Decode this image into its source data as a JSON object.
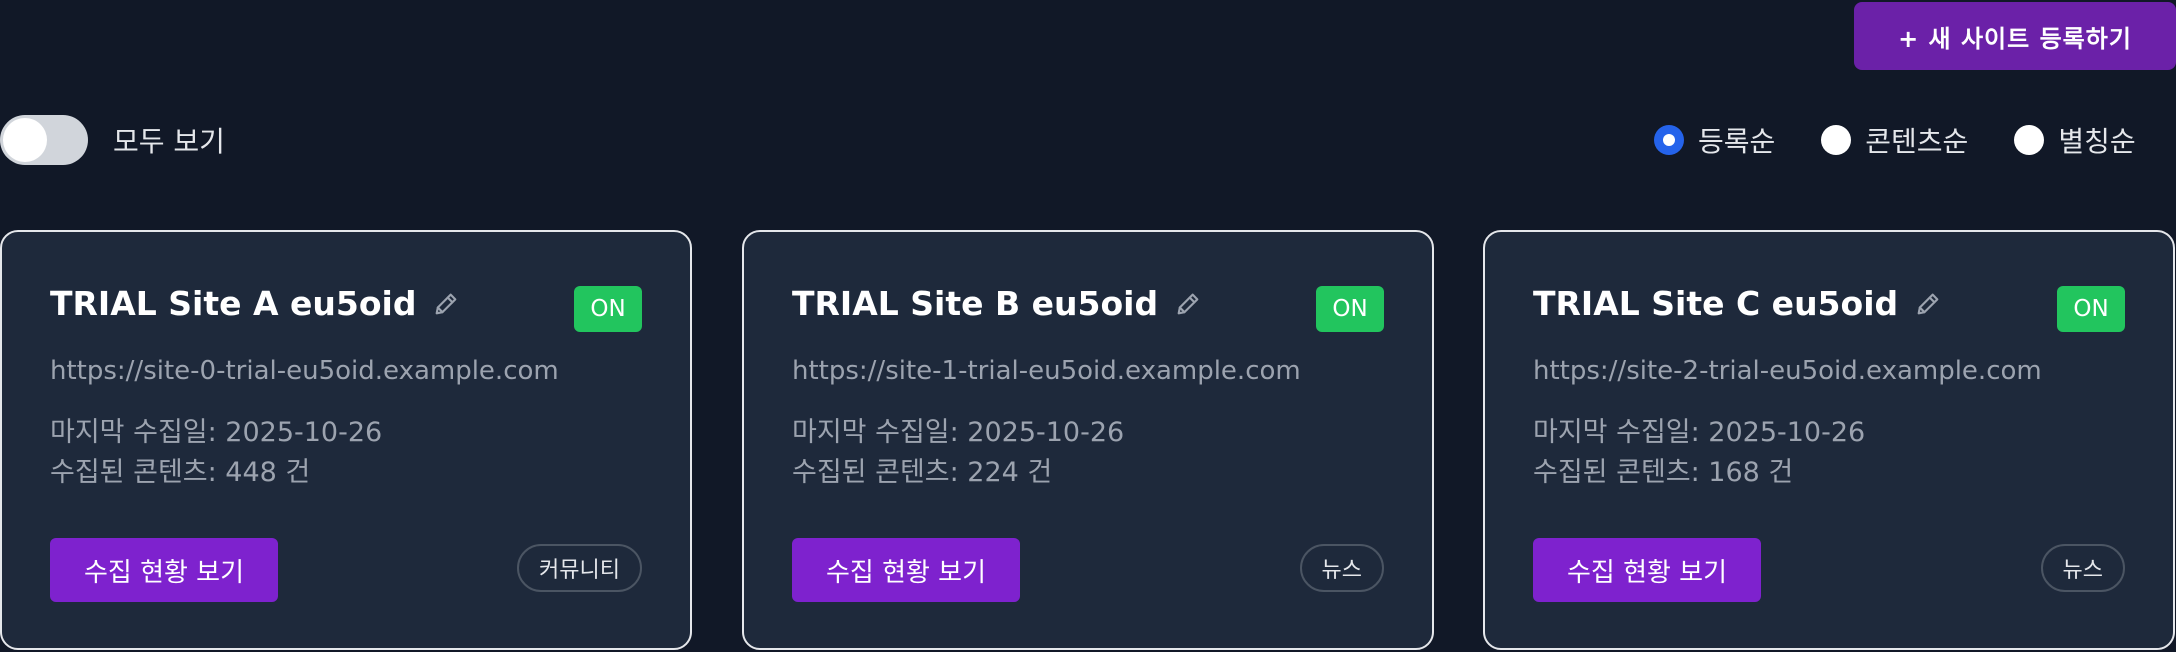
{
  "header": {
    "register_button": "+ 새 사이트 등록하기"
  },
  "filters": {
    "show_all_label": "모두 보기",
    "show_all_on": false
  },
  "sort": {
    "options": [
      {
        "label": "등록순",
        "checked": true
      },
      {
        "label": "콘텐츠순",
        "checked": false
      },
      {
        "label": "별칭순",
        "checked": false
      }
    ]
  },
  "sites": [
    {
      "name": "TRIAL Site A eu5oid",
      "status": "ON",
      "url": "https://site-0-trial-eu5oid.example.com",
      "last_collected": "마지막 수집일: 2025-10-26",
      "collected_count": "수집된 콘텐츠: 448 건",
      "view_button": "수집 현황 보기",
      "tag": "커뮤니티"
    },
    {
      "name": "TRIAL Site B eu5oid",
      "status": "ON",
      "url": "https://site-1-trial-eu5oid.example.com",
      "last_collected": "마지막 수집일: 2025-10-26",
      "collected_count": "수집된 콘텐츠: 224 건",
      "view_button": "수집 현황 보기",
      "tag": "뉴스"
    },
    {
      "name": "TRIAL Site C eu5oid",
      "status": "ON",
      "url": "https://site-2-trial-eu5oid.example.com",
      "last_collected": "마지막 수집일: 2025-10-26",
      "collected_count": "수집된 콘텐츠: 168 건",
      "view_button": "수집 현황 보기",
      "tag": "뉴스"
    }
  ],
  "colors": {
    "background": "#111827",
    "card": "#1e293b",
    "primary": "#7e22ce",
    "register": "#6b21a8",
    "status_on": "#22c55e",
    "radio_checked": "#2563eb"
  },
  "icons": {
    "edit": "pencil-icon"
  }
}
